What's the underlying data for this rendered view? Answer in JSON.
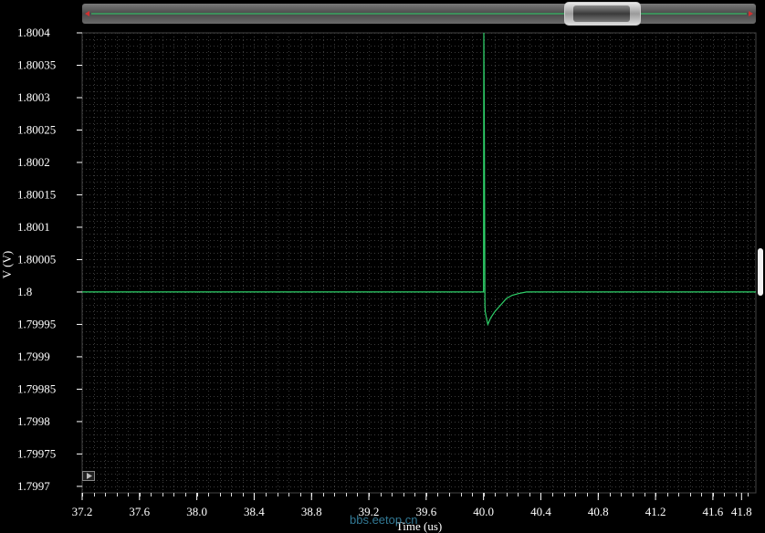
{
  "chart_data": {
    "type": "line",
    "title": "",
    "xlabel": "Time (us)",
    "ylabel": "V (V)",
    "xlim": [
      37.2,
      41.9
    ],
    "ylim": [
      1.79969,
      1.8004
    ],
    "x_ticks": [
      "37.2",
      "37.6",
      "38.0",
      "38.4",
      "38.8",
      "39.2",
      "39.6",
      "40.0",
      "40.4",
      "40.8",
      "41.2",
      "41.6",
      "41.8"
    ],
    "y_ticks": [
      "1.8004",
      "1.80035",
      "1.8003",
      "1.80025",
      "1.8002",
      "1.80015",
      "1.8001",
      "1.80005",
      "1.8",
      "1.79995",
      "1.7999",
      "1.79985",
      "1.7998",
      "1.79975",
      "1.7997"
    ],
    "grid": true,
    "series": [
      {
        "color": "#2fd26a",
        "x": [
          37.2,
          39.995,
          40.0,
          40.002,
          40.006,
          40.01,
          40.012,
          40.02,
          40.03,
          40.05,
          40.08,
          40.12,
          40.16,
          40.2,
          40.25,
          40.3,
          40.4,
          41.9
        ],
        "y": [
          1.8,
          1.8,
          1.8,
          1.8004,
          1.80023,
          1.79998,
          1.79997,
          1.79996,
          1.79995,
          1.79996,
          1.79997,
          1.79998,
          1.79999,
          1.799995,
          1.799998,
          1.8,
          1.8,
          1.8
        ]
      }
    ]
  },
  "watermark": "bbs.eetop.cn"
}
